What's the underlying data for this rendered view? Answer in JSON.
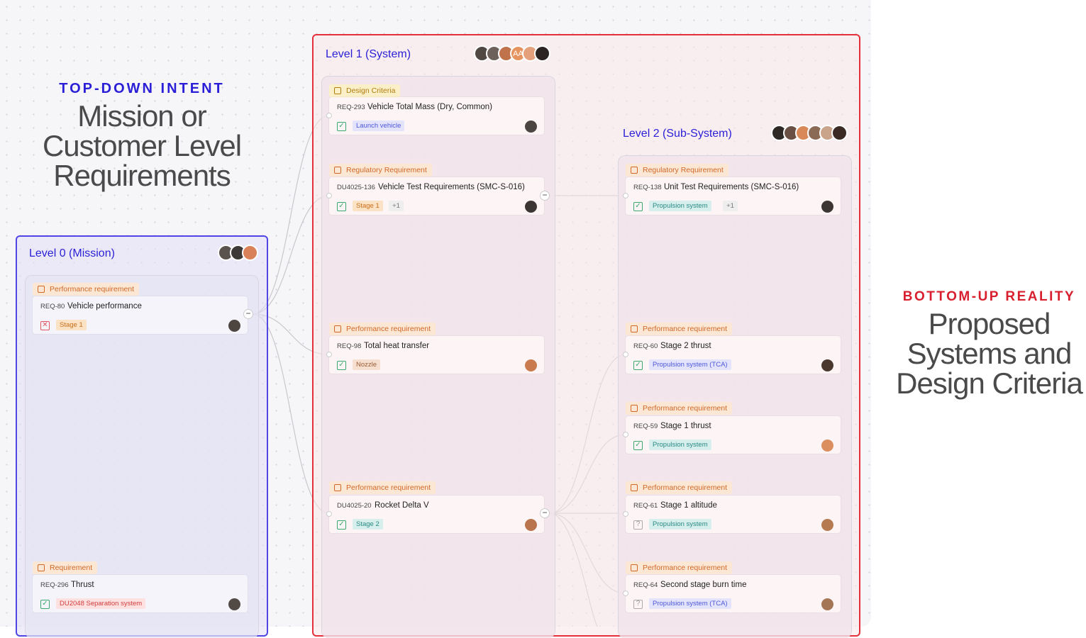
{
  "left_label": {
    "kicker": "TOP-DOWN INTENT",
    "line1": "Mission or",
    "line2": "Customer Level",
    "line3": "Requirements"
  },
  "right_label": {
    "kicker": "BOTTOM-UP REALITY",
    "line1": "Proposed",
    "line2": "Systems and",
    "line3": "Design Criteria"
  },
  "colors": {
    "level0": "#5046e5",
    "level1": "#e5303c",
    "kicker_left": "#2a1fd6",
    "kicker_right": "#d81f2e"
  },
  "levels": [
    {
      "title": "Level 0 (Mission)",
      "avatars": [
        "#5a524c",
        "#3d3937",
        "#d9825a"
      ],
      "cards": [
        {
          "chip": "Performance requirement",
          "id": "REQ-80",
          "title": "Vehicle performance",
          "status": "x",
          "tags": [
            {
              "text": "Stage 1",
              "color": "orange"
            }
          ],
          "more": "",
          "owner": "#4c4540"
        },
        {
          "chip": "Requirement",
          "id": "REQ-296",
          "title": "Thrust",
          "status": "check",
          "tags": [
            {
              "text": "DU2048 Separation system",
              "color": "red"
            }
          ],
          "more": "",
          "owner": "#524a44"
        }
      ]
    },
    {
      "title": "Level 1 (System)",
      "avatars": [
        "#4f4843",
        "#6d625b",
        "#c0724b",
        "#e6945f",
        "#e3a07a",
        "#2b2422"
      ],
      "avatar_text": "AA",
      "cards": [
        {
          "chip": "Design Criteria",
          "id": "REQ-293",
          "title": "Vehicle Total Mass (Dry, Common)",
          "status": "check",
          "tags": [
            {
              "text": "Launch vehicle",
              "color": "blue"
            }
          ],
          "more": "",
          "owner": "#4b4541"
        },
        {
          "chip": "Regulatory Requirement",
          "id": "DU4025-136",
          "title": "Vehicle Test Requirements (SMC-S-016)",
          "status": "check",
          "tags": [
            {
              "text": "Stage 1",
              "color": "orange"
            }
          ],
          "more": "+1",
          "owner": "#3b3633"
        },
        {
          "chip": "Performance requirement",
          "id": "REQ-98",
          "title": "Total heat transfer",
          "status": "check",
          "tags": [
            {
              "text": "Nozzle",
              "color": "brown"
            }
          ],
          "more": "",
          "owner": "#c97b4f"
        },
        {
          "chip": "Performance requirement",
          "id": "DU4025-20",
          "title": "Rocket Delta V",
          "status": "check",
          "tags": [
            {
              "text": "Stage 2",
              "color": "teal"
            }
          ],
          "more": "",
          "owner": "#b9744e"
        }
      ]
    },
    {
      "title": "Level 2 (Sub-System)",
      "avatars": [
        "#2f2926",
        "#6a5044",
        "#d98958",
        "#8b6a55",
        "#c9a38a",
        "#3b2b24"
      ],
      "cards": [
        {
          "chip": "Regulatory Requirement",
          "id": "REQ-138",
          "title": "Unit Test Requirements (SMC-S-016)",
          "status": "check",
          "tags": [
            {
              "text": "Propulsion system",
              "color": "teal"
            }
          ],
          "more": "+1",
          "owner": "#3b3633"
        },
        {
          "chip": "Performance requirement",
          "id": "REQ-60",
          "title": "Stage 2 thrust",
          "status": "check",
          "tags": [
            {
              "text": "Propulsion system (TCA)",
              "color": "blue"
            }
          ],
          "more": "",
          "owner": "#4a372d"
        },
        {
          "chip": "Performance requirement",
          "id": "REQ-59",
          "title": "Stage 1 thrust",
          "status": "check",
          "tags": [
            {
              "text": "Propulsion system",
              "color": "teal"
            }
          ],
          "more": "",
          "owner": "#db8f5e"
        },
        {
          "chip": "Performance requirement",
          "id": "REQ-61",
          "title": "Stage 1 altitude",
          "status": "q",
          "tags": [
            {
              "text": "Propulsion system",
              "color": "teal"
            }
          ],
          "more": "",
          "owner": "#b57a52"
        },
        {
          "chip": "Performance requirement",
          "id": "REQ-64",
          "title": "Second stage burn time",
          "status": "q",
          "tags": [
            {
              "text": "Propulsion system (TCA)",
              "color": "blue"
            }
          ],
          "more": "",
          "owner": "#a57656"
        }
      ]
    }
  ]
}
